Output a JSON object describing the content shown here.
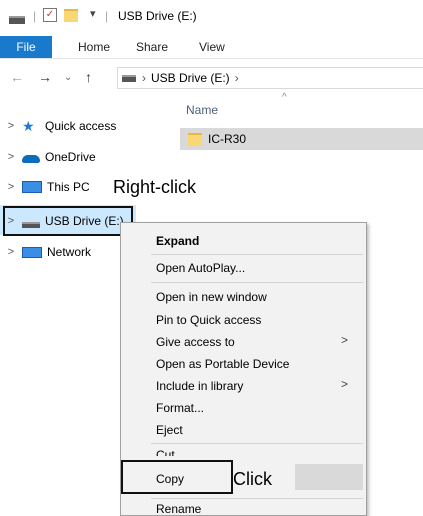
{
  "window": {
    "title": "USB Drive (E:)"
  },
  "ribbon": {
    "file": "File",
    "home": "Home",
    "share": "Share",
    "view": "View"
  },
  "address": {
    "location": "USB Drive (E:)",
    "sep": "›"
  },
  "nav_pane": {
    "quick_access": "Quick access",
    "onedrive": "OneDrive",
    "this_pc": "This PC",
    "usb_drive": "USB Drive (E:)",
    "network": "Network"
  },
  "content": {
    "column_name": "Name",
    "folder": "IC-R30"
  },
  "annotations": {
    "right_click": "Right-click",
    "click": "Click"
  },
  "context_menu": {
    "expand": "Expand",
    "open_autoplay": "Open AutoPlay...",
    "open_new_window": "Open in new window",
    "pin_quick_access": "Pin to Quick access",
    "give_access": "Give access to",
    "open_portable": "Open as Portable Device",
    "include_library": "Include in library",
    "format": "Format...",
    "eject": "Eject",
    "cut": "Cut",
    "copy": "Copy",
    "rename": "Rename"
  },
  "colors": {
    "file_tab": "#1979ca",
    "selection": "#cce8ff",
    "row_highlight": "#d9d9d9"
  }
}
